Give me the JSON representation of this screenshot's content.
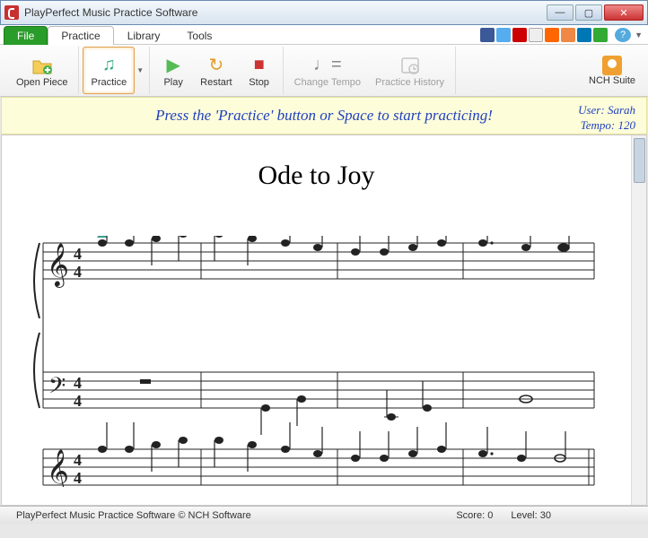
{
  "window": {
    "title": "PlayPerfect Music Practice Software"
  },
  "menu": {
    "file": "File",
    "tabs": [
      "Practice",
      "Library",
      "Tools"
    ],
    "active": "Practice"
  },
  "toolbar": {
    "open_piece": "Open Piece",
    "practice": "Practice",
    "play": "Play",
    "restart": "Restart",
    "stop": "Stop",
    "change_tempo": "Change Tempo",
    "practice_history": "Practice History",
    "nch_suite": "NCH Suite"
  },
  "banner": {
    "message": "Press the 'Practice' button or Space to start practicing!",
    "user_label": "User:",
    "user_name": "Sarah",
    "tempo_label": "Tempo:",
    "tempo_value": "120"
  },
  "piece": {
    "title": "Ode to Joy",
    "time_signature": "4/4",
    "clef_top": "treble",
    "clef_bottom": "bass"
  },
  "status": {
    "app": "PlayPerfect Music Practice Software © NCH Software",
    "score_label": "Score:",
    "score_value": "0",
    "level_label": "Level:",
    "level_value": "30"
  },
  "help": "?"
}
